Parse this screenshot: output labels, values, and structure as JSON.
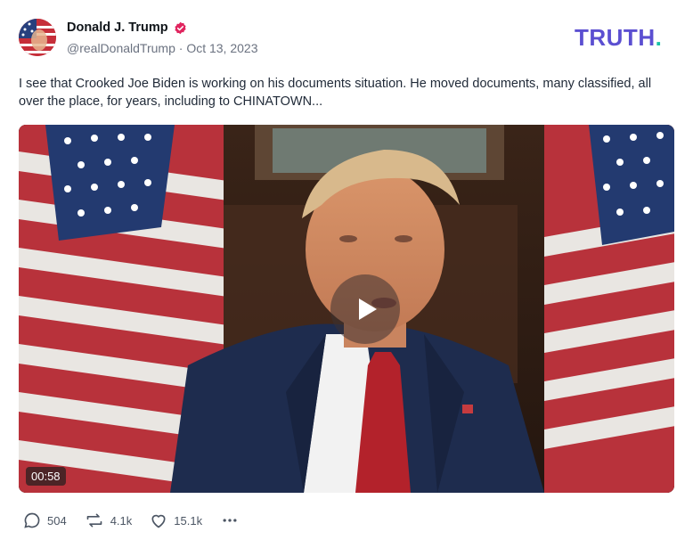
{
  "author": {
    "display_name": "Donald J. Trump",
    "handle": "@realDonaldTrump",
    "separator": "·",
    "date": "Oct 13, 2023",
    "verified": true
  },
  "brand": {
    "text": "TRUTH",
    "dot": ".",
    "color": "#5b4fd1",
    "dot_color": "#17c1a6"
  },
  "post": {
    "text": "I see that Crooked Joe Biden is working on his documents situation. He moved documents, many classified, all over the place, for years, including to CHINATOWN..."
  },
  "video": {
    "duration": "00:58",
    "play_icon": "play-icon"
  },
  "actions": {
    "replies": "504",
    "retruths": "4.1k",
    "likes": "15.1k",
    "more_icon": "more-icon"
  }
}
